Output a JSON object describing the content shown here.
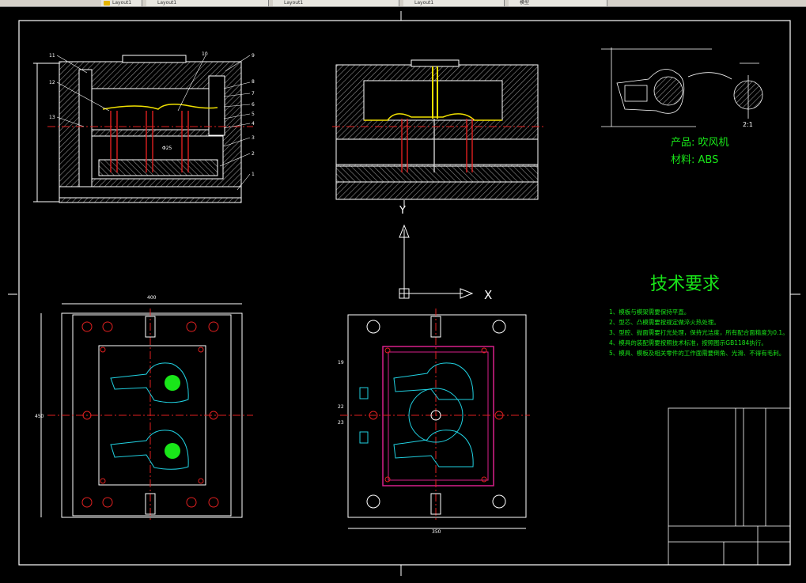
{
  "tabs": [
    {
      "label": "Layout1"
    },
    {
      "label": "Layout1"
    },
    {
      "label": "Layout1"
    },
    {
      "label": "Layout1"
    },
    {
      "label": "模型"
    }
  ],
  "colors": {
    "background": "#000000",
    "line": "#ffffff",
    "hatch": "#8c8c8c",
    "title": "#19e619",
    "text_green": "#19e619",
    "red": "#e02020",
    "magenta": "#d8208a",
    "yellow": "#f0e000",
    "cyan": "#20d0e0"
  },
  "product": {
    "product_label": "产品: 吹风机",
    "material_label": "材料: ABS"
  },
  "tech": {
    "title": "技术要求",
    "items": [
      "1、模板与模架需要保持平直。",
      "2、型芯、凸模需要按规定做淬火热处理。",
      "3、型腔、抛面需要打光处理，保持光洁度，所有配合面精度为0.1。",
      "4、模具的装配需要按照技术标准，按照图示GB1184执行。",
      "5、模具、模板及相关零件的工作面需要倒角、光滑、不得有毛刺。"
    ]
  },
  "axis": {
    "y": "Y",
    "x": "X"
  },
  "dims": {
    "width_400": "400",
    "height_450": "450",
    "bottom_350": "350",
    "phi25": "Φ25"
  },
  "labels": {
    "l1": "1",
    "l2": "2",
    "l3": "3",
    "l4": "4",
    "l5": "5",
    "l6": "6",
    "l7": "7",
    "l8": "8",
    "l9": "9",
    "l10": "10",
    "l11": "11",
    "l12": "12",
    "l13": "13",
    "l19": "19",
    "l22": "22",
    "l23": "23",
    "r21": "2:1"
  }
}
